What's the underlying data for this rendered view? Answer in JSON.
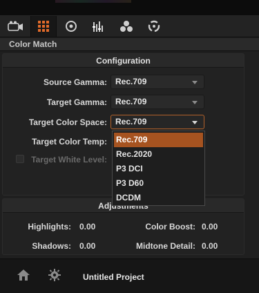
{
  "colors": {
    "accent": "#a65320",
    "focus_border": "#b4622a",
    "toolbar_active_icon": "#e26b2b",
    "text": "#d8d8d8",
    "disabled_text": "#6a6a6a"
  },
  "toolbar": {
    "tools": [
      {
        "name": "camera-icon",
        "active": false
      },
      {
        "name": "grid-icon",
        "active": true
      },
      {
        "name": "circle-icon",
        "active": false
      },
      {
        "name": "bars-icon",
        "active": false
      },
      {
        "name": "color-wheels-icon",
        "active": false
      },
      {
        "name": "cycle-icon",
        "active": false
      }
    ]
  },
  "panel": {
    "title": "Color Match"
  },
  "configuration": {
    "title": "Configuration",
    "source_gamma": {
      "label": "Source Gamma:",
      "value": "Rec.709"
    },
    "target_gamma": {
      "label": "Target Gamma:",
      "value": "Rec.709"
    },
    "target_color_space": {
      "label": "Target Color Space:",
      "value": "Rec.709"
    },
    "target_color_temp": {
      "label": "Target Color Temp:"
    },
    "target_white_level": {
      "label": "Target White Level:"
    }
  },
  "dropdown": {
    "options": [
      "Rec.709",
      "Rec.2020",
      "P3 DCI",
      "P3 D60",
      "DCDM"
    ],
    "selected_index": 0
  },
  "adjustments": {
    "title": "Adjustments",
    "highlights": {
      "label": "Highlights:",
      "value": "0.00"
    },
    "shadows": {
      "label": "Shadows:",
      "value": "0.00"
    },
    "color_boost": {
      "label": "Color Boost:",
      "value": "0.00"
    },
    "midtone_detail": {
      "label": "Midtone Detail:",
      "value": "0.00"
    }
  },
  "bottombar": {
    "project_name": "Untitled Project"
  }
}
